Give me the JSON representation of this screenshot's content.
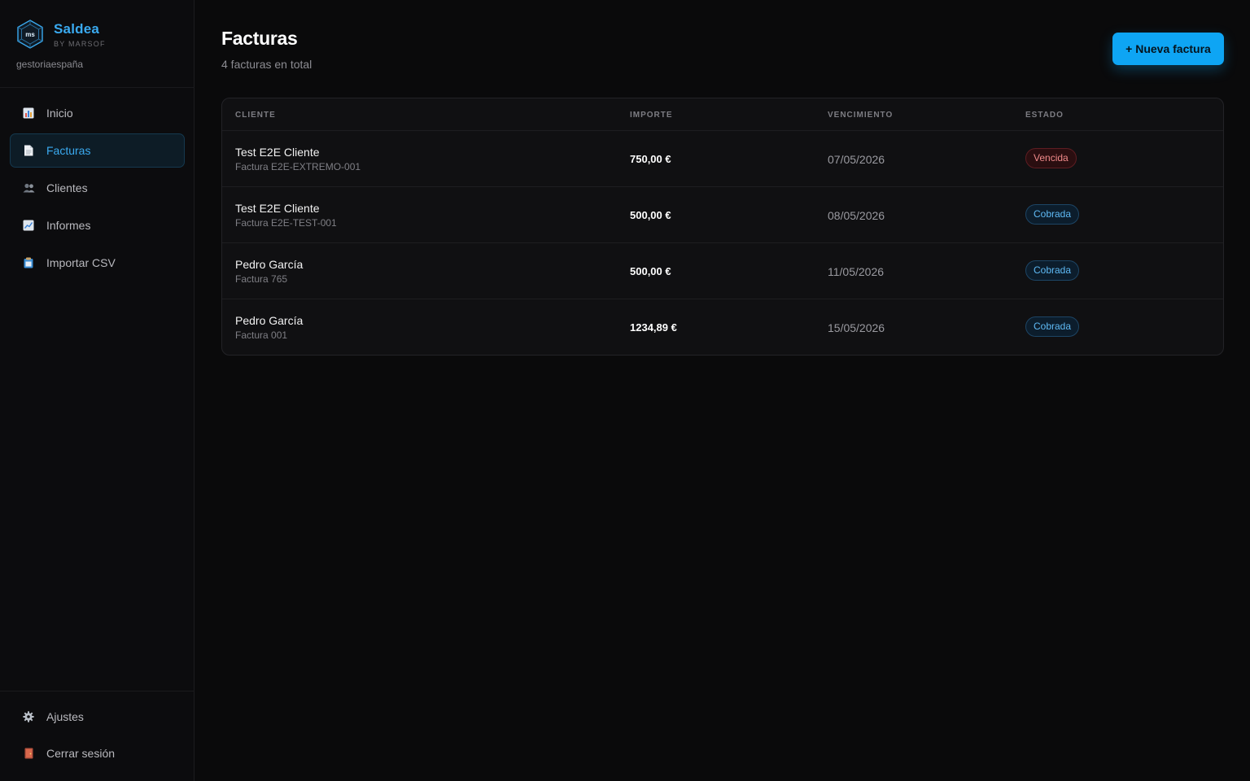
{
  "brand": {
    "name": "Saldea",
    "by": "BY MARSOF",
    "logo_text": "ms",
    "org": "gestoriaespaña",
    "accent": "#3aaaf0"
  },
  "nav": {
    "items": [
      {
        "label": "Inicio",
        "icon": "bar-chart-icon",
        "active": false
      },
      {
        "label": "Facturas",
        "icon": "document-icon",
        "active": true
      },
      {
        "label": "Clientes",
        "icon": "users-icon",
        "active": false
      },
      {
        "label": "Informes",
        "icon": "trend-chart-icon",
        "active": false
      },
      {
        "label": "Importar CSV",
        "icon": "clipboard-icon",
        "active": false
      }
    ],
    "bottom": [
      {
        "label": "Ajustes",
        "icon": "gear-icon"
      },
      {
        "label": "Cerrar sesión",
        "icon": "door-icon"
      }
    ]
  },
  "header": {
    "title": "Facturas",
    "subtitle": "4 facturas en total",
    "new_button": "+ Nueva factura",
    "button_color": "#0ea5f4"
  },
  "table": {
    "columns": [
      "CLIENTE",
      "IMPORTE",
      "VENCIMIENTO",
      "ESTADO"
    ],
    "rows": [
      {
        "client": "Test E2E Cliente",
        "invoice": "Factura E2E-EXTREMO-001",
        "amount": "750,00 €",
        "due": "07/05/2026",
        "status": "Vencida",
        "status_type": "vencida"
      },
      {
        "client": "Test E2E Cliente",
        "invoice": "Factura E2E-TEST-001",
        "amount": "500,00 €",
        "due": "08/05/2026",
        "status": "Cobrada",
        "status_type": "cobrada"
      },
      {
        "client": "Pedro García",
        "invoice": "Factura 765",
        "amount": "500,00 €",
        "due": "11/05/2026",
        "status": "Cobrada",
        "status_type": "cobrada"
      },
      {
        "client": "Pedro García",
        "invoice": "Factura 001",
        "amount": "1234,89 €",
        "due": "15/05/2026",
        "status": "Cobrada",
        "status_type": "cobrada"
      }
    ]
  }
}
